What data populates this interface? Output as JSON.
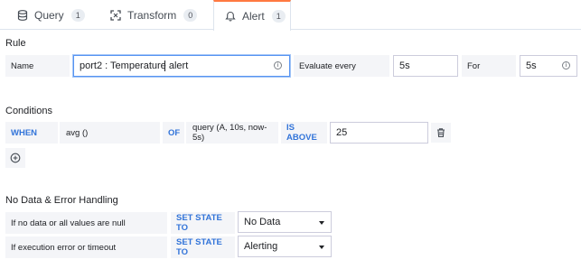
{
  "tabs": [
    {
      "label": "Query",
      "count": "1",
      "icon": "database-icon"
    },
    {
      "label": "Transform",
      "count": "0",
      "icon": "transform-icon"
    },
    {
      "label": "Alert",
      "count": "1",
      "icon": "bell-icon",
      "active": true
    }
  ],
  "rule": {
    "title": "Rule",
    "name_label": "Name",
    "name_value": "port2 : Temperature alert",
    "evaluate_label": "Evaluate every",
    "evaluate_value": "5s",
    "for_label": "For",
    "for_value": "5s"
  },
  "conditions": {
    "title": "Conditions",
    "when": "WHEN",
    "reducer": "avg ()",
    "of": "OF",
    "query": "query (A, 10s, now-5s)",
    "evaluator": "IS ABOVE",
    "threshold": "25"
  },
  "nodata": {
    "title": "No Data & Error Handling",
    "rows": [
      {
        "label": "If no data or all values are null",
        "action": "SET STATE TO",
        "value": "No Data"
      },
      {
        "label": "If execution error or timeout",
        "action": "SET STATE TO",
        "value": "Alerting"
      }
    ]
  },
  "colors": {
    "accent": "#ff7941",
    "keyword": "#3274d9",
    "focus_border": "#5794f2"
  }
}
